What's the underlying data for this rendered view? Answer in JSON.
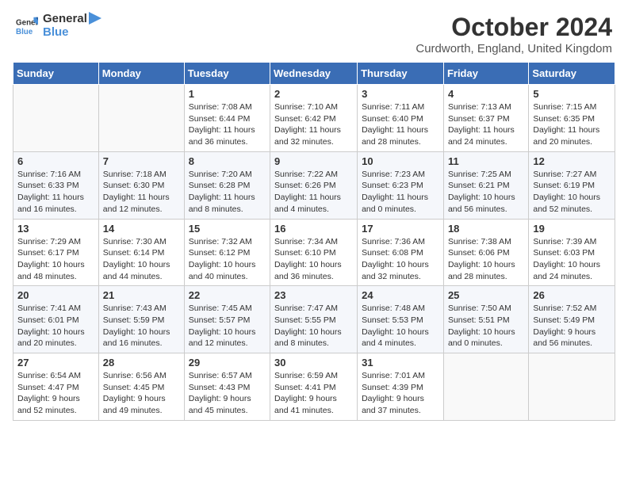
{
  "logo": {
    "text_general": "General",
    "text_blue": "Blue"
  },
  "header": {
    "month": "October 2024",
    "location": "Curdworth, England, United Kingdom"
  },
  "days_of_week": [
    "Sunday",
    "Monday",
    "Tuesday",
    "Wednesday",
    "Thursday",
    "Friday",
    "Saturday"
  ],
  "weeks": [
    [
      {
        "day": "",
        "info": ""
      },
      {
        "day": "",
        "info": ""
      },
      {
        "day": "1",
        "info": "Sunrise: 7:08 AM\nSunset: 6:44 PM\nDaylight: 11 hours and 36 minutes."
      },
      {
        "day": "2",
        "info": "Sunrise: 7:10 AM\nSunset: 6:42 PM\nDaylight: 11 hours and 32 minutes."
      },
      {
        "day": "3",
        "info": "Sunrise: 7:11 AM\nSunset: 6:40 PM\nDaylight: 11 hours and 28 minutes."
      },
      {
        "day": "4",
        "info": "Sunrise: 7:13 AM\nSunset: 6:37 PM\nDaylight: 11 hours and 24 minutes."
      },
      {
        "day": "5",
        "info": "Sunrise: 7:15 AM\nSunset: 6:35 PM\nDaylight: 11 hours and 20 minutes."
      }
    ],
    [
      {
        "day": "6",
        "info": "Sunrise: 7:16 AM\nSunset: 6:33 PM\nDaylight: 11 hours and 16 minutes."
      },
      {
        "day": "7",
        "info": "Sunrise: 7:18 AM\nSunset: 6:30 PM\nDaylight: 11 hours and 12 minutes."
      },
      {
        "day": "8",
        "info": "Sunrise: 7:20 AM\nSunset: 6:28 PM\nDaylight: 11 hours and 8 minutes."
      },
      {
        "day": "9",
        "info": "Sunrise: 7:22 AM\nSunset: 6:26 PM\nDaylight: 11 hours and 4 minutes."
      },
      {
        "day": "10",
        "info": "Sunrise: 7:23 AM\nSunset: 6:23 PM\nDaylight: 11 hours and 0 minutes."
      },
      {
        "day": "11",
        "info": "Sunrise: 7:25 AM\nSunset: 6:21 PM\nDaylight: 10 hours and 56 minutes."
      },
      {
        "day": "12",
        "info": "Sunrise: 7:27 AM\nSunset: 6:19 PM\nDaylight: 10 hours and 52 minutes."
      }
    ],
    [
      {
        "day": "13",
        "info": "Sunrise: 7:29 AM\nSunset: 6:17 PM\nDaylight: 10 hours and 48 minutes."
      },
      {
        "day": "14",
        "info": "Sunrise: 7:30 AM\nSunset: 6:14 PM\nDaylight: 10 hours and 44 minutes."
      },
      {
        "day": "15",
        "info": "Sunrise: 7:32 AM\nSunset: 6:12 PM\nDaylight: 10 hours and 40 minutes."
      },
      {
        "day": "16",
        "info": "Sunrise: 7:34 AM\nSunset: 6:10 PM\nDaylight: 10 hours and 36 minutes."
      },
      {
        "day": "17",
        "info": "Sunrise: 7:36 AM\nSunset: 6:08 PM\nDaylight: 10 hours and 32 minutes."
      },
      {
        "day": "18",
        "info": "Sunrise: 7:38 AM\nSunset: 6:06 PM\nDaylight: 10 hours and 28 minutes."
      },
      {
        "day": "19",
        "info": "Sunrise: 7:39 AM\nSunset: 6:03 PM\nDaylight: 10 hours and 24 minutes."
      }
    ],
    [
      {
        "day": "20",
        "info": "Sunrise: 7:41 AM\nSunset: 6:01 PM\nDaylight: 10 hours and 20 minutes."
      },
      {
        "day": "21",
        "info": "Sunrise: 7:43 AM\nSunset: 5:59 PM\nDaylight: 10 hours and 16 minutes."
      },
      {
        "day": "22",
        "info": "Sunrise: 7:45 AM\nSunset: 5:57 PM\nDaylight: 10 hours and 12 minutes."
      },
      {
        "day": "23",
        "info": "Sunrise: 7:47 AM\nSunset: 5:55 PM\nDaylight: 10 hours and 8 minutes."
      },
      {
        "day": "24",
        "info": "Sunrise: 7:48 AM\nSunset: 5:53 PM\nDaylight: 10 hours and 4 minutes."
      },
      {
        "day": "25",
        "info": "Sunrise: 7:50 AM\nSunset: 5:51 PM\nDaylight: 10 hours and 0 minutes."
      },
      {
        "day": "26",
        "info": "Sunrise: 7:52 AM\nSunset: 5:49 PM\nDaylight: 9 hours and 56 minutes."
      }
    ],
    [
      {
        "day": "27",
        "info": "Sunrise: 6:54 AM\nSunset: 4:47 PM\nDaylight: 9 hours and 52 minutes."
      },
      {
        "day": "28",
        "info": "Sunrise: 6:56 AM\nSunset: 4:45 PM\nDaylight: 9 hours and 49 minutes."
      },
      {
        "day": "29",
        "info": "Sunrise: 6:57 AM\nSunset: 4:43 PM\nDaylight: 9 hours and 45 minutes."
      },
      {
        "day": "30",
        "info": "Sunrise: 6:59 AM\nSunset: 4:41 PM\nDaylight: 9 hours and 41 minutes."
      },
      {
        "day": "31",
        "info": "Sunrise: 7:01 AM\nSunset: 4:39 PM\nDaylight: 9 hours and 37 minutes."
      },
      {
        "day": "",
        "info": ""
      },
      {
        "day": "",
        "info": ""
      }
    ]
  ]
}
